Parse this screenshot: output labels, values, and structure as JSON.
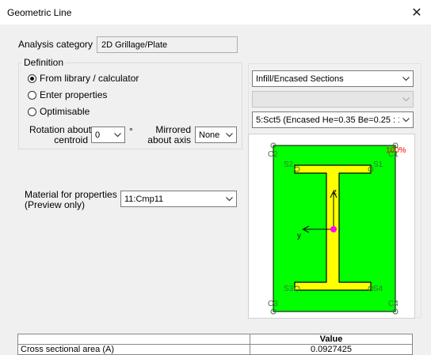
{
  "window": {
    "title": "Geometric Line"
  },
  "analysis": {
    "label": "Analysis category",
    "value": "2D Grillage/Plate"
  },
  "definition": {
    "title": "Definition",
    "options": [
      "From library / calculator",
      "Enter properties",
      "Optimisable"
    ],
    "selected": "From library / calculator",
    "rotation_label_1": "Rotation about",
    "rotation_label_2": "centroid",
    "rotation_value": "0",
    "rotation_unit": "°",
    "mirrored_label_1": "Mirrored",
    "mirrored_label_2": "about axis",
    "mirrored_value": "None"
  },
  "material": {
    "label_1": "Material for properties",
    "label_2": "(Preview only)",
    "value": "11:Cmp11"
  },
  "section": {
    "type_value": "Infill/Encased Sections",
    "disabled_value": "",
    "section_value": "5:Sct5 (Encased He=0.35 Be=0.25 : 1"
  },
  "preview": {
    "colors": {
      "fill": "#00ff00",
      "flange": "#ffff00",
      "centroid": "#ff00ff",
      "outline": "#000000",
      "points": "#3a7a3a"
    },
    "labels": {
      "c1": "C1",
      "c2": "C2",
      "c3": "C3",
      "c4": "C4",
      "s1": "S1",
      "s2": "S2",
      "s3": "S3",
      "s4": "S4",
      "axis_z": "z",
      "axis_y": "y",
      "zoom": "100%"
    }
  },
  "properties": {
    "header_value": "Value",
    "rows": [
      {
        "name": "Cross sectional area (A)",
        "value": "0.0927425"
      }
    ]
  }
}
